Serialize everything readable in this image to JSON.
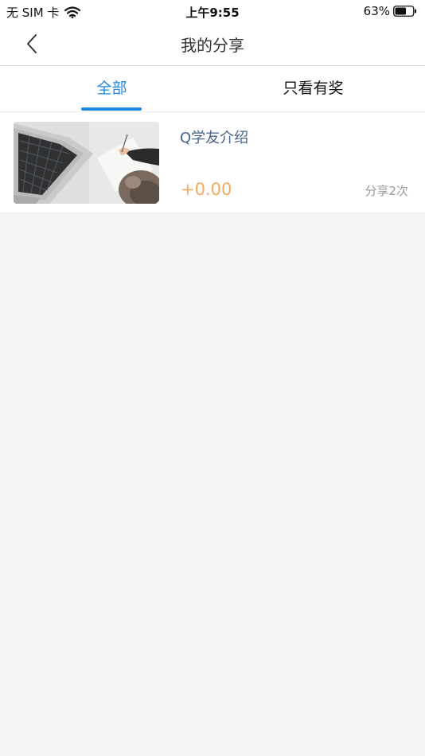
{
  "status_bar": {
    "carrier": "无 SIM 卡",
    "wifi_icon": "wifi-icon",
    "time": "上午9:55",
    "battery_percent": "63%",
    "battery_level": 0.63
  },
  "nav": {
    "back_icon": "chevron-left-icon",
    "title": "我的分享"
  },
  "tabs": [
    {
      "label": "全部",
      "active": true
    },
    {
      "label": "只看有奖",
      "active": false
    }
  ],
  "colors": {
    "accent": "#1e88e5",
    "reward": "#f5a95c",
    "item_title": "#45628a",
    "background": "#f4f4f4"
  },
  "shares": [
    {
      "title": "Q学友介绍",
      "reward": "+0.00",
      "share_count": "分享2次",
      "thumbnail": "laptop-writing-photo"
    }
  ]
}
